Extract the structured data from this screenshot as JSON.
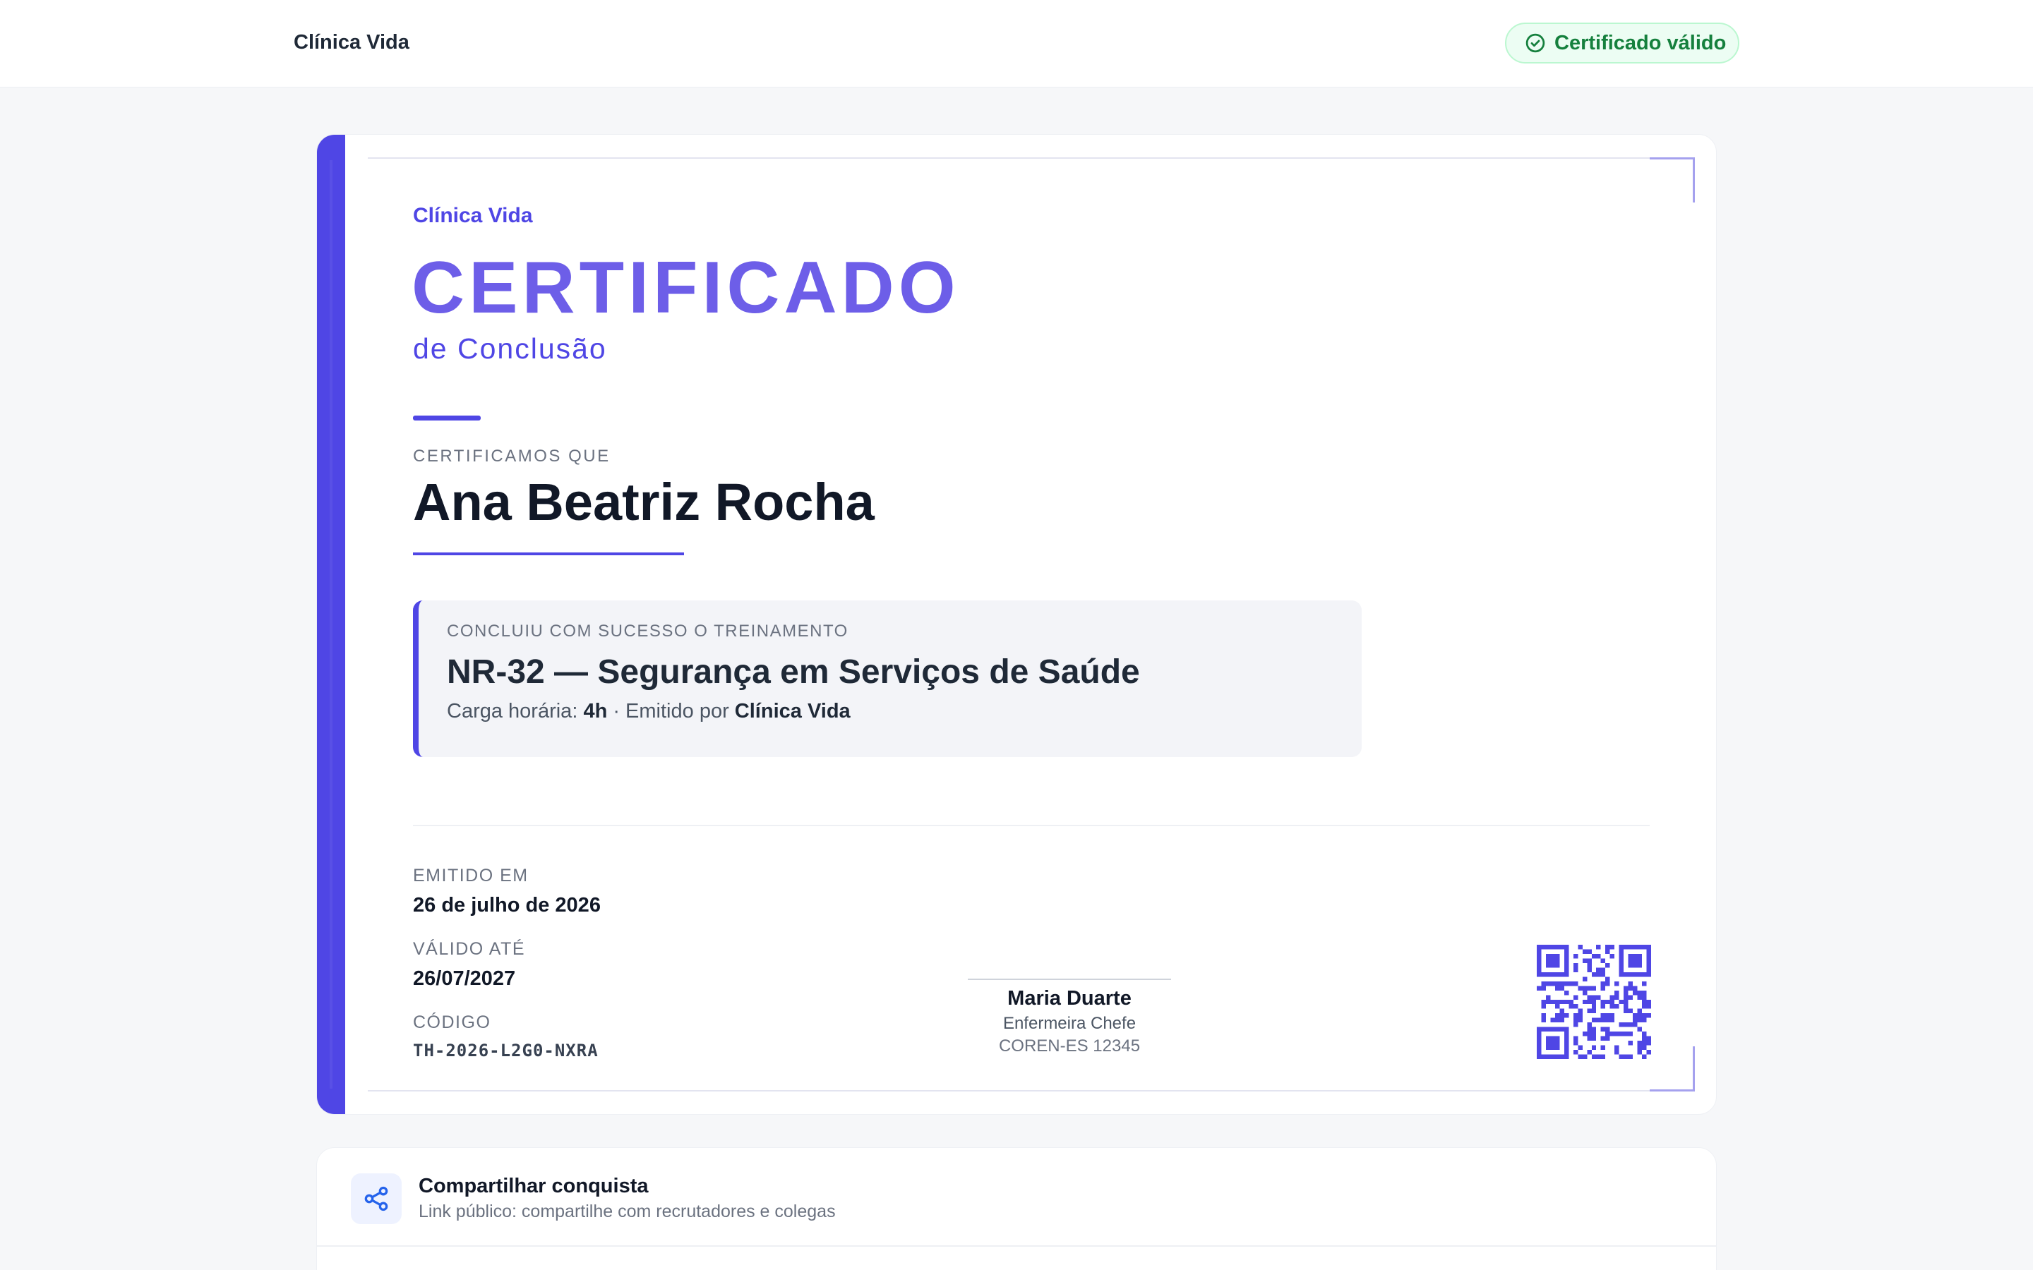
{
  "header": {
    "brand": "Clínica Vida",
    "badge_label": "Certificado válido"
  },
  "certificate": {
    "issuer": "Clínica Vida",
    "title": "CERTIFICADO",
    "subtitle": "de Conclusão",
    "certify_label": "CERTIFICAMOS QUE",
    "recipient_name": "Ana Beatriz Rocha",
    "course_label": "CONCLUIU COM SUCESSO O TREINAMENTO",
    "course_name": "NR-32 — Segurança em Serviços de Saúde",
    "workload_label": "Carga horária:",
    "workload_value": "4h",
    "issued_by_label": "· Emitido por",
    "issued_by_value": "Clínica Vida",
    "issued_on_label": "EMITIDO EM",
    "issued_on_value": "26 de julho de 2026",
    "valid_until_label": "VÁLIDO ATÉ",
    "valid_until_value": "26/07/2027",
    "code_label": "CÓDIGO",
    "code_value": "TH-2026-L2G0-NXRA",
    "signer_name": "Maria Duarte",
    "signer_role": "Enfermeira Chefe",
    "signer_registration": "COREN-ES 12345"
  },
  "share": {
    "title": "Compartilhar conquista",
    "subtitle": "Link público: compartilhe com recrutadores e colegas"
  },
  "colors": {
    "accent": "#4f46e5",
    "title": "#6d5ee8",
    "success": "#15803d"
  },
  "icons": {
    "badge": "check-circle-icon",
    "share": "share-icon",
    "qr": "qr-code-icon"
  }
}
